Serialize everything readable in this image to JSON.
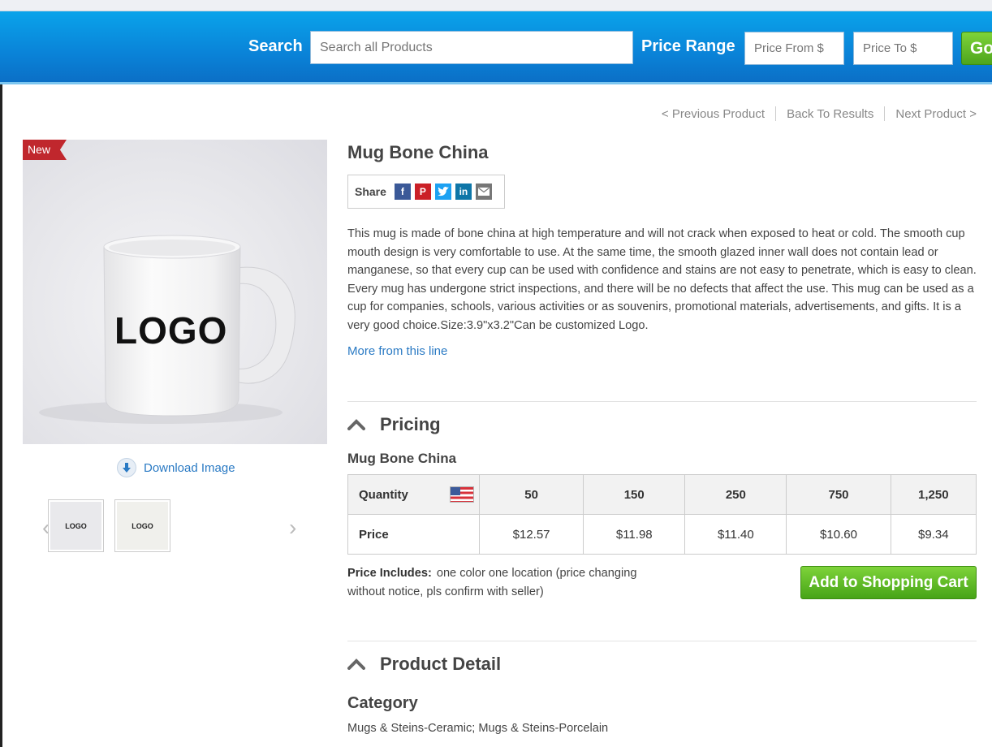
{
  "header": {
    "search_label": "Search",
    "search_placeholder": "Search all Products",
    "price_range_label": "Price Range",
    "price_from_placeholder": "Price From $",
    "price_to_placeholder": "Price To $",
    "go_label": "Go"
  },
  "nav": {
    "previous": "< Previous Product",
    "back": "Back To Results",
    "next": "Next Product >"
  },
  "product": {
    "badge": "New",
    "image_text": "LOGO",
    "download_label": "Download Image",
    "thumb_text": "LOGO",
    "title": "Mug Bone China",
    "share_label": "Share",
    "share_icons": [
      "facebook-icon",
      "pinterest-icon",
      "twitter-icon",
      "linkedin-icon",
      "email-icon"
    ],
    "description": "This mug is made of bone china at high temperature and will not crack when exposed to heat or cold. The smooth cup mouth design is very comfortable to use. At the same time, the smooth glazed inner wall does not contain lead or manganese, so that every cup can be used with confidence and stains are not easy to penetrate, which is easy to clean. Every mug has undergone strict inspections, and there will be no defects that affect the use. This mug can be used as a cup for companies, schools, various activities or as souvenirs, promotional materials, advertisements, and gifts. It is a very good choice.Size:3.9\"x3.2\"Can be customized Logo.",
    "more_link": "More from this line"
  },
  "pricing": {
    "heading": "Pricing",
    "subtitle": "Mug Bone China",
    "quantity_label": "Quantity",
    "price_label": "Price",
    "quantities": [
      "50",
      "150",
      "250",
      "750",
      "1,250"
    ],
    "prices": [
      "$12.57",
      "$11.98",
      "$11.40",
      "$10.60",
      "$9.34"
    ],
    "includes_label": "Price Includes:",
    "includes_text": "one color one location (price changing without notice, pls confirm with seller)",
    "cart_button": "Add to Shopping Cart"
  },
  "detail": {
    "heading": "Product Detail",
    "category_label": "Category",
    "category_value": "Mugs & Steins-Ceramic; Mugs & Steins-Porcelain"
  },
  "colors": {
    "header_blue": "#0a8fe0",
    "green_button": "#5cb82a",
    "link_blue": "#2a7ac4",
    "badge_red": "#c0272d"
  }
}
